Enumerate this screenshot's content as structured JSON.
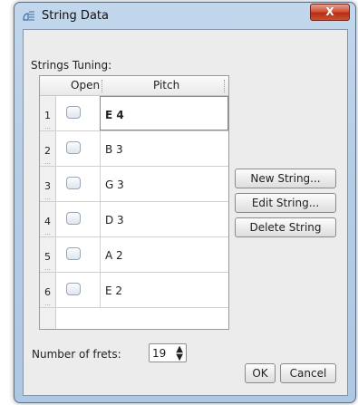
{
  "window": {
    "title": "String Data",
    "close_label": "X"
  },
  "tuning": {
    "section_label": "Strings Tuning:",
    "columns": {
      "open": "Open",
      "pitch": "Pitch"
    },
    "rows": [
      {
        "number": "1",
        "pitch": "E 4",
        "open": false,
        "selected": true
      },
      {
        "number": "2",
        "pitch": "B 3",
        "open": false,
        "selected": false
      },
      {
        "number": "3",
        "pitch": "G 3",
        "open": false,
        "selected": false
      },
      {
        "number": "4",
        "pitch": "D 3",
        "open": false,
        "selected": false
      },
      {
        "number": "5",
        "pitch": "A 2",
        "open": false,
        "selected": false
      },
      {
        "number": "6",
        "pitch": "E 2",
        "open": false,
        "selected": false
      }
    ]
  },
  "actions": {
    "new_string": "New String...",
    "edit_string": "Edit String...",
    "delete_string": "Delete String"
  },
  "frets": {
    "label": "Number of frets:",
    "value": "19"
  },
  "footer": {
    "ok": "OK",
    "cancel": "Cancel"
  },
  "icons": {
    "app": "guitar-tuning-icon",
    "spinner": "up-down-arrows-icon"
  },
  "colors": {
    "title_bar": "#b6cde6",
    "close_button": "#c9502f",
    "client_background": "#ececec"
  }
}
